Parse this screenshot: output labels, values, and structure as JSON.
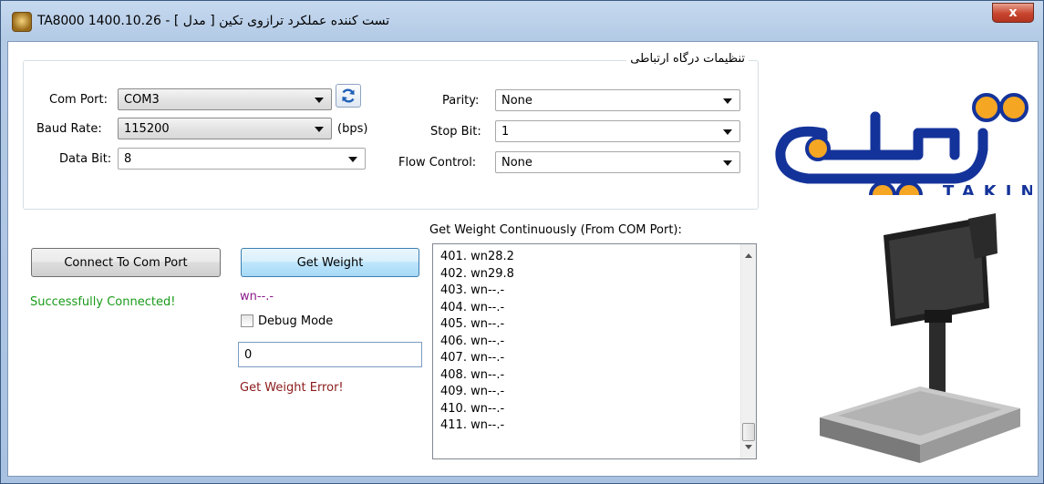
{
  "window": {
    "title": "TA8000 تست کننده عملکرد ترازوی تکین [ مدل ] - 1400.10.26",
    "close_label": "x"
  },
  "settings_group": {
    "legend": "تنظیمات درگاه ارتباطی",
    "com_port": {
      "label": "Com Port:",
      "value": "COM3"
    },
    "baud_rate": {
      "label": "Baud Rate:",
      "value": "115200",
      "unit": "(bps)"
    },
    "data_bit": {
      "label": "Data Bit:",
      "value": "8"
    },
    "parity": {
      "label": "Parity:",
      "value": "None"
    },
    "stop_bit": {
      "label": "Stop Bit:",
      "value": "1"
    },
    "flow_control": {
      "label": "Flow Control:",
      "value": "None"
    }
  },
  "connect": {
    "button_label": "Connect To Com Port",
    "status": "Successfully Connected!"
  },
  "weight": {
    "button_label": "Get Weight",
    "raw_value": "wn--.-",
    "debug_label": "Debug Mode",
    "debug_checked": false,
    "input_value": "0",
    "error": "Get Weight Error!"
  },
  "log": {
    "title": "Get Weight Continuously (From COM Port):",
    "lines": [
      "401. wn28.2",
      "402. wn29.8",
      "403. wn--.-",
      "404. wn--.-",
      "405. wn--.-",
      "406. wn--.-",
      "407. wn--.-",
      "408. wn--.-",
      "409. wn--.-",
      "410. wn--.-",
      "411. wn--.-"
    ]
  },
  "logo": {
    "text": "TAKIN"
  },
  "colors": {
    "success": "#1a9a1a",
    "error": "#8b1a1a",
    "raw": "#8b1a8b",
    "logo_blue": "#14339a",
    "logo_orange": "#f5a623"
  }
}
